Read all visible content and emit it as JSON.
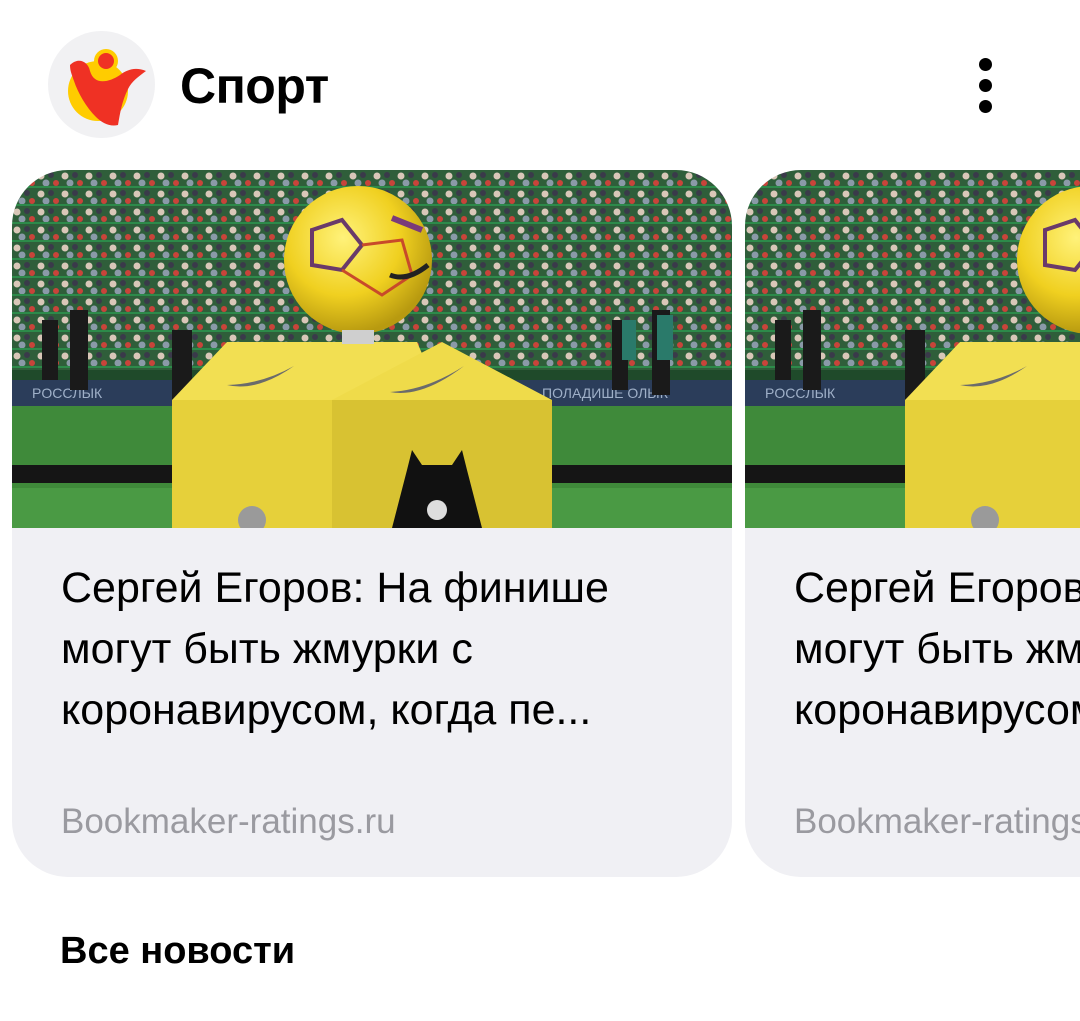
{
  "header": {
    "title": "Спорт",
    "logo_icon": "yandex-sport-logo-icon",
    "more_icon": "more-vertical-icon"
  },
  "cards": [
    {
      "title": "Сергей Егоров: На финише могут быть жмурки с коронавирусом, когда пе...",
      "source": "Bookmaker-ratings.ru",
      "image_icon": "football-ball-on-stand-image"
    },
    {
      "title": "Сергей Егоров: На финише могут быть жмурки с коронавирусом, когда пе...",
      "source": "Bookmaker-ratings.ru",
      "image_icon": "football-ball-on-stand-image"
    }
  ],
  "footer": {
    "all_news_label": "Все новости"
  },
  "colors": {
    "card_background": "#f0f0f4",
    "source_text": "#9a9aa0",
    "logo_red": "#ef3124",
    "logo_yellow": "#ffcc00",
    "stand_yellow": "#e8d53a",
    "pitch_green": "#3f8a3a"
  }
}
